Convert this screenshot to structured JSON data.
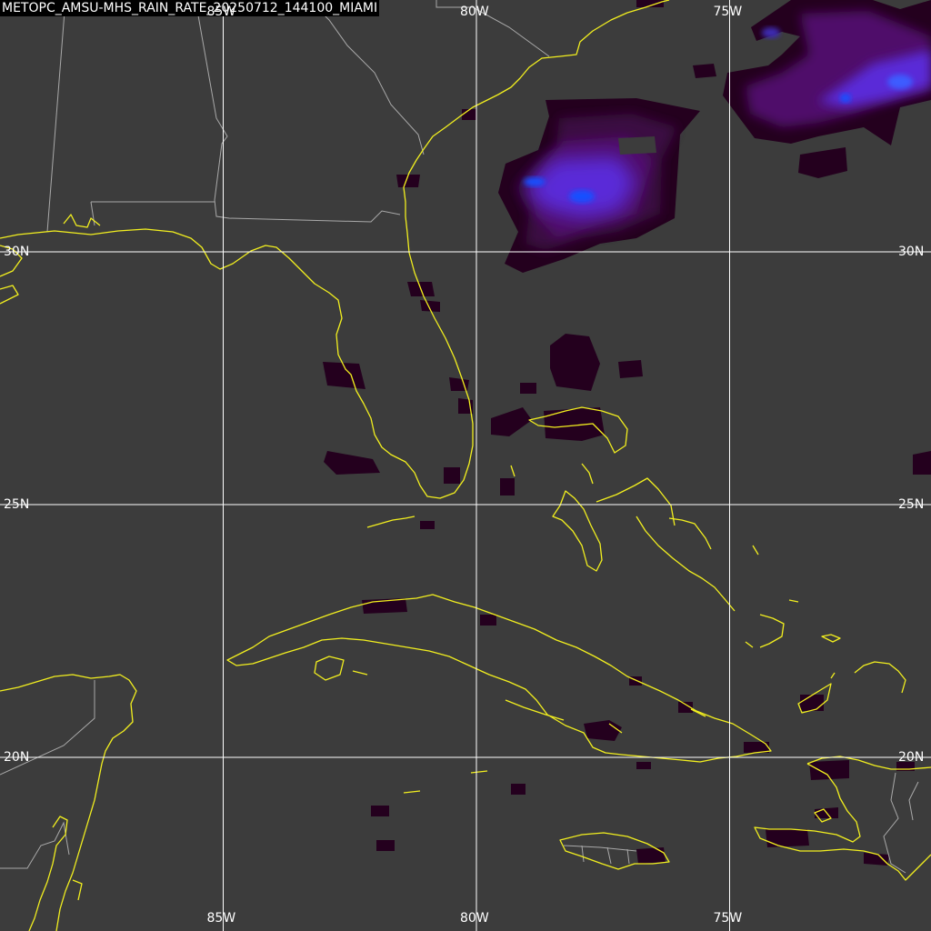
{
  "title": "METOPC_AMSU-MHS_RAIN_RATE_20250712_144100_MIAMI",
  "grid": {
    "longitudes": [
      {
        "label": "85W",
        "lon": -85
      },
      {
        "label": "80W",
        "lon": -80
      },
      {
        "label": "75W",
        "lon": -75
      }
    ],
    "latitudes": [
      {
        "label": "30N",
        "lat": 30
      },
      {
        "label": "25N",
        "lat": 25
      },
      {
        "label": "20N",
        "lat": 20
      }
    ]
  },
  "colors": {
    "background": "#3c3c3c",
    "coastline": "#f2ef1f",
    "borders": "#a9a9a9",
    "gridlines": "#ffffff",
    "rain_low": "#24001e",
    "rain_mid": "#50106a",
    "rain_high": "#5a2bd8",
    "rain_peak": "#1750ff"
  },
  "layers": [
    "rain-rate",
    "coastlines",
    "state-borders",
    "lat-lon-grid"
  ]
}
